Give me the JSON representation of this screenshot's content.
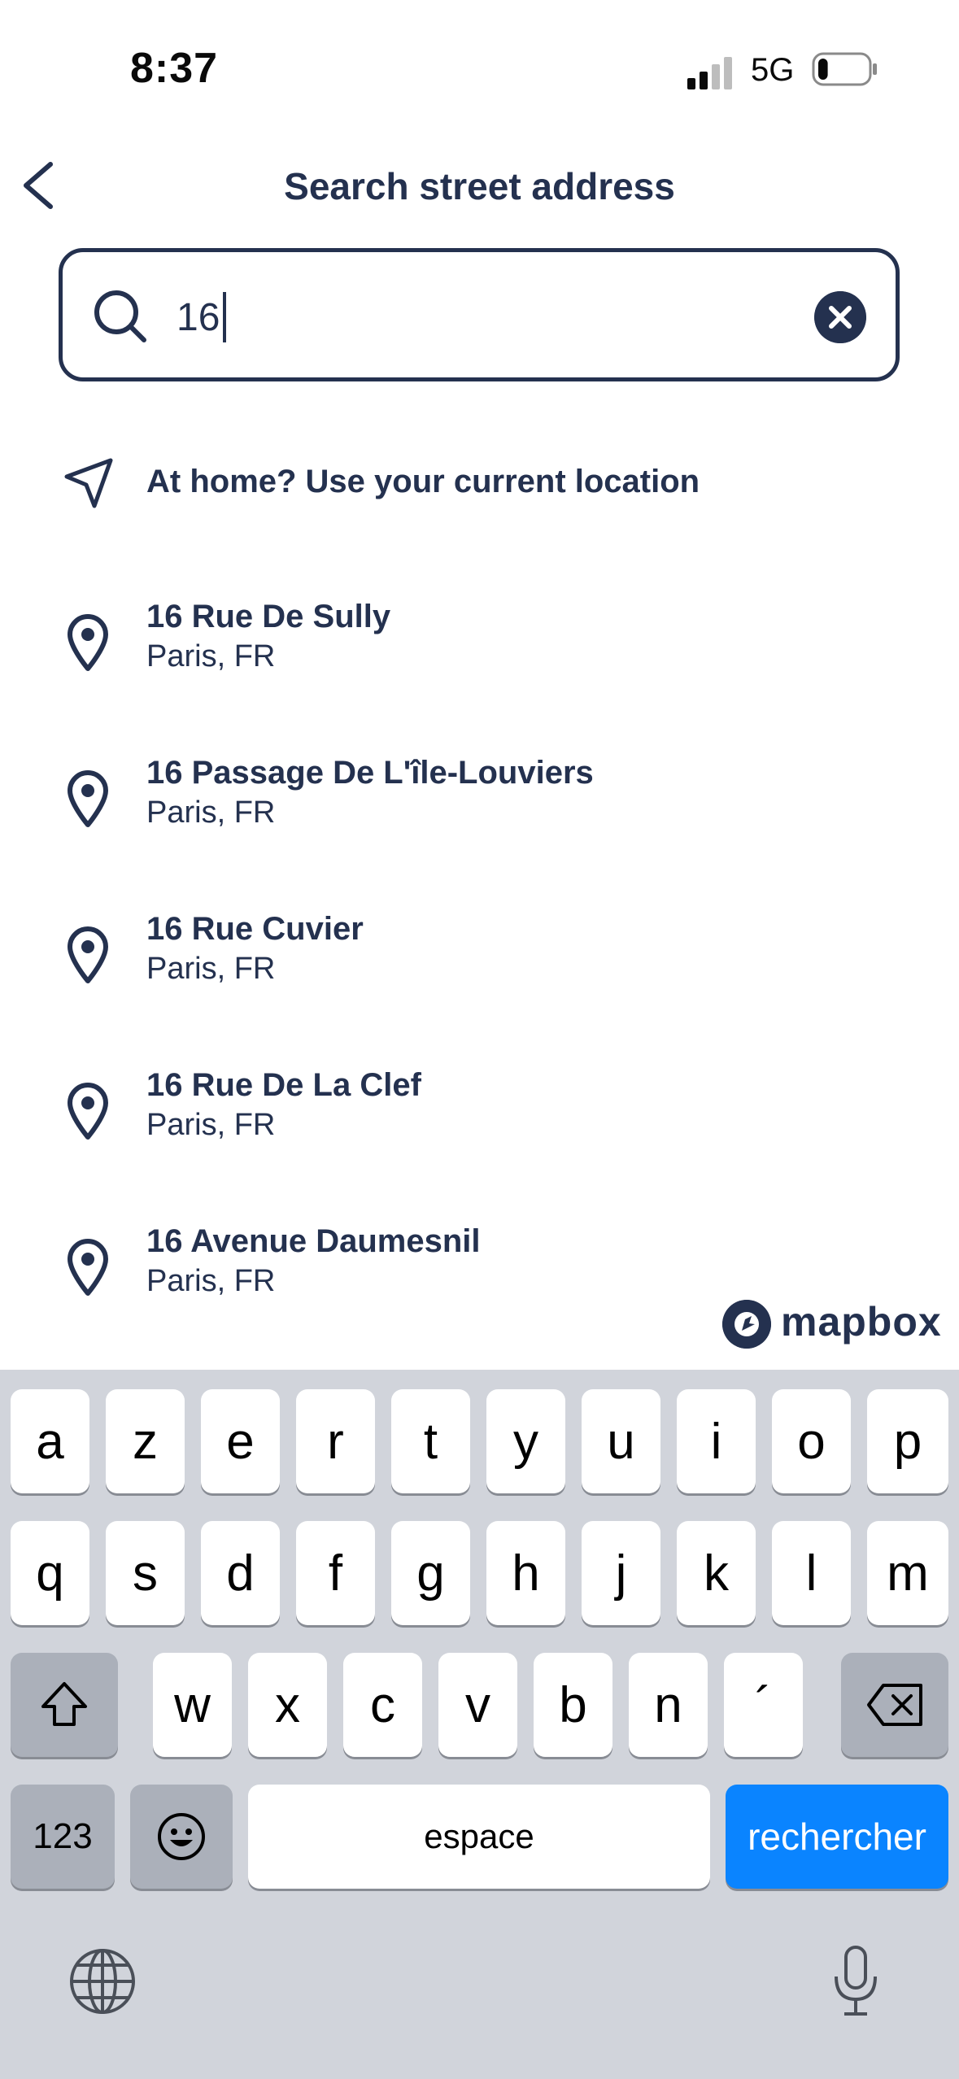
{
  "status_bar": {
    "time": "8:37",
    "network": "5G",
    "battery_level": 0.2
  },
  "header": {
    "title": "Search street address"
  },
  "search": {
    "value": "16",
    "placeholder": ""
  },
  "current_location": {
    "label": "At home? Use your current location"
  },
  "results": [
    {
      "title": "16 Rue De Sully",
      "subtitle": "Paris, FR"
    },
    {
      "title": "16 Passage De L'île-Louviers",
      "subtitle": "Paris, FR"
    },
    {
      "title": "16 Rue Cuvier",
      "subtitle": "Paris, FR"
    },
    {
      "title": "16 Rue De La Clef",
      "subtitle": "Paris, FR"
    },
    {
      "title": "16 Avenue Daumesnil",
      "subtitle": "Paris, FR"
    }
  ],
  "attribution": {
    "brand": "mapbox"
  },
  "keyboard": {
    "row1": [
      "a",
      "z",
      "e",
      "r",
      "t",
      "y",
      "u",
      "i",
      "o",
      "p"
    ],
    "row2": [
      "q",
      "s",
      "d",
      "f",
      "g",
      "h",
      "j",
      "k",
      "l",
      "m"
    ],
    "row3": [
      "w",
      "x",
      "c",
      "v",
      "b",
      "n",
      "´"
    ],
    "numbers_label": "123",
    "space_label": "espace",
    "return_label": "rechercher"
  },
  "colors": {
    "text": "#24314f",
    "accent": "#0a84ff",
    "keyboard_bg": "#d1d4db"
  }
}
